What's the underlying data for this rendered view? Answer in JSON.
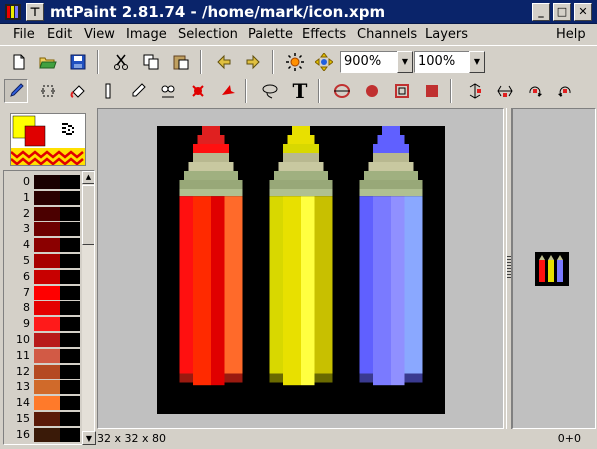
{
  "window": {
    "title": "mtPaint 2.81.74 - /home/mark/icon.xpm",
    "pin_label": "⊤",
    "minimize_label": "_",
    "maximize_label": "□",
    "close_label": "✕"
  },
  "menu": [
    "File",
    "Edit",
    "View",
    "Image",
    "Selection",
    "Palette",
    "Effects",
    "Channels",
    "Layers",
    "Help"
  ],
  "toolbar1": {
    "zoom_value": "900%",
    "opacity_value": "100%",
    "icons": [
      "new-file-icon",
      "open-file-icon",
      "save-file-icon",
      "cut-icon",
      "copy-icon",
      "paste-icon",
      "undo-arrow-icon",
      "redo-arrow-icon",
      "brightness-icon",
      "pan-icon"
    ]
  },
  "toolbar2": {
    "icons": [
      "paint-brush-icon",
      "shuffle-icon",
      "flood-fill-icon",
      "line-tool-icon",
      "smudge-icon",
      "clone-icon",
      "select-rect-icon",
      "select-polygon-icon",
      "lasso-icon",
      "text-icon",
      "ellipse-outline-icon",
      "ellipse-filled-icon",
      "rect-outline-icon",
      "rect-filled-icon",
      "flip-vertical-icon",
      "flip-horizontal-icon",
      "rotate-cw-icon",
      "rotate-ccw-icon"
    ]
  },
  "palette": {
    "colors": [
      "#190000",
      "#2a0000",
      "#4b0000",
      "#6d0000",
      "#8b0000",
      "#a80000",
      "#c80000",
      "#ff0000",
      "#e40000",
      "#ff1a1a",
      "#b81a1a",
      "#d25a45",
      "#b54a22",
      "#d06a2a",
      "#ff7a2a",
      "#5a1a08",
      "#3a1a08"
    ],
    "numbers": [
      "0",
      "1",
      "2",
      "3",
      "4",
      "5",
      "6",
      "7",
      "8",
      "9",
      "10",
      "11",
      "12",
      "13",
      "14",
      "15",
      "16"
    ]
  },
  "status": {
    "image_info": "32 x 32 x 80",
    "cursor_pos": "0+0"
  },
  "colors": {
    "titlebar": "#0a246a",
    "canvas_bg": "#c0c0c0",
    "red_pencil": "#ff0000",
    "yellow_pencil": "#e8e000",
    "blue_pencil": "#7a7aff"
  }
}
